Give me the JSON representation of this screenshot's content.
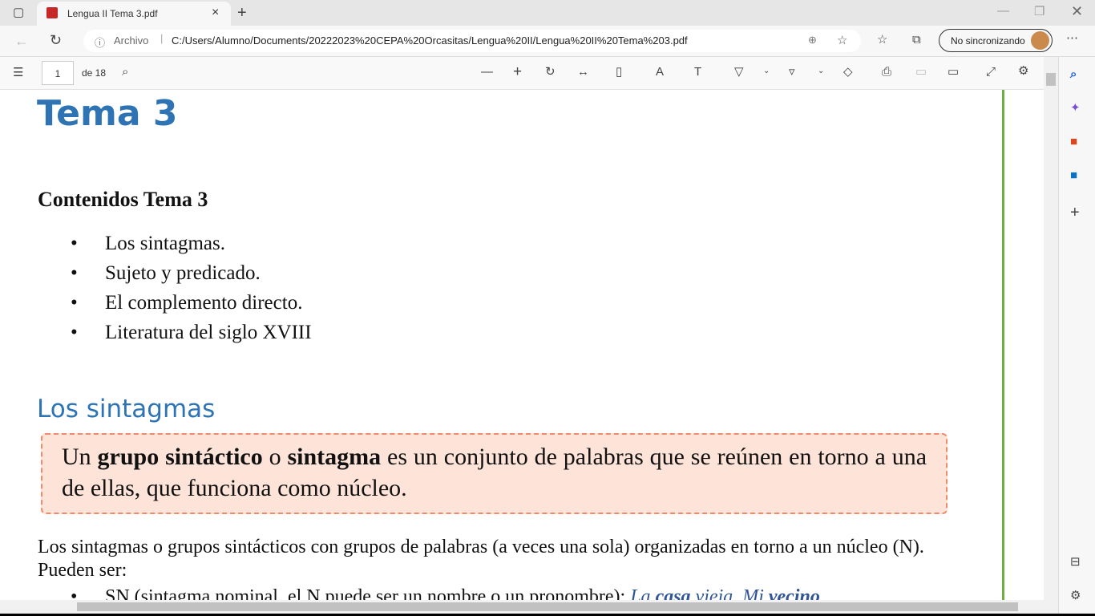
{
  "browser": {
    "tab_title": "Lengua II Tema 3.pdf",
    "url_label": "Archivo",
    "url": "C:/Users/Alumno/Documents/20222023%20CEPA%20Orcasitas/Lengua%20II/Lengua%20II%20Tema%203.pdf",
    "profile_label": "No sincronizando"
  },
  "pdf_toolbar": {
    "page": "1",
    "page_total": "de 18"
  },
  "document": {
    "title": "Tema 3",
    "contents_heading": "Contenidos Tema 3",
    "contents": [
      "Los sintagmas.",
      "Sujeto y predicado.",
      "El complemento directo.",
      "Literatura del siglo XVIII"
    ],
    "section_heading": "Los sintagmas",
    "box": {
      "p1": "Un ",
      "b1": "grupo sintáctico",
      "p2": " o ",
      "b2": "sintagma",
      "p3": " es un conjunto de palabras que se reúnen en torno a una de ellas, que funciona como núcleo."
    },
    "paragraph": "Los sintagmas o grupos sintácticos con grupos de palabras (a veces una sola) organizadas en torno a un núcleo (N). Pueden ser:",
    "bullet": {
      "text": "SN (sintagma nominal, el N puede ser un nombre o un pronombre): ",
      "ex1": "La ",
      "ex1b": "casa",
      "ex1c": " vieja, ",
      "ex2": "Mi ",
      "ex2b": "vecino"
    }
  }
}
